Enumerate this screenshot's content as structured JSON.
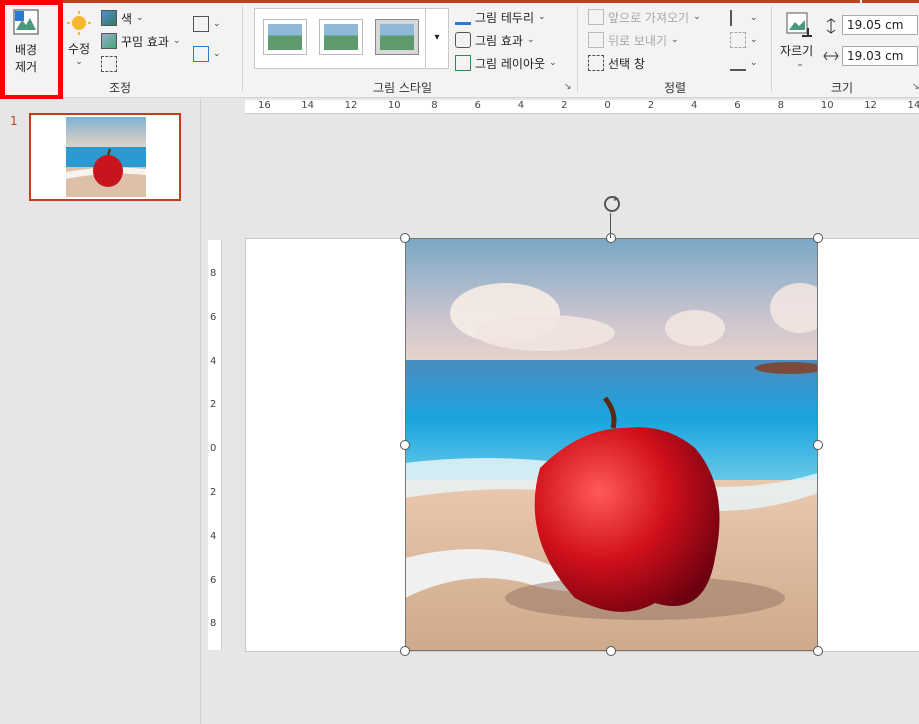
{
  "ribbon": {
    "remove_background": {
      "line1": "배경",
      "line2": "제거"
    },
    "corrections": "수정",
    "color": "색",
    "artistic_effects": "꾸밈 효과",
    "adjust_group": "조정",
    "picture_styles_group": "그림 스타일",
    "picture_border": "그림 테두리",
    "picture_effects": "그림 효과",
    "picture_layout": "그림 레이아웃",
    "bring_forward": "앞으로 가져오기",
    "send_backward": "뒤로 보내기",
    "selection_pane": "선택 창",
    "arrange_group": "정렬",
    "crop": "자르기",
    "height": "19.05 cm",
    "width": "19.03 cm",
    "size_group": "크기"
  },
  "slides_panel": {
    "slide_number": "1"
  },
  "ruler_h": [
    "16",
    "14",
    "12",
    "10",
    "8",
    "6",
    "4",
    "2",
    "0",
    "2",
    "4",
    "6",
    "8",
    "10",
    "12",
    "14"
  ],
  "ruler_v": [
    "8",
    "6",
    "4",
    "2",
    "0",
    "2",
    "4",
    "6",
    "8"
  ],
  "colors": {
    "accent": "#c43e1c",
    "highlight": "#ff0000"
  }
}
